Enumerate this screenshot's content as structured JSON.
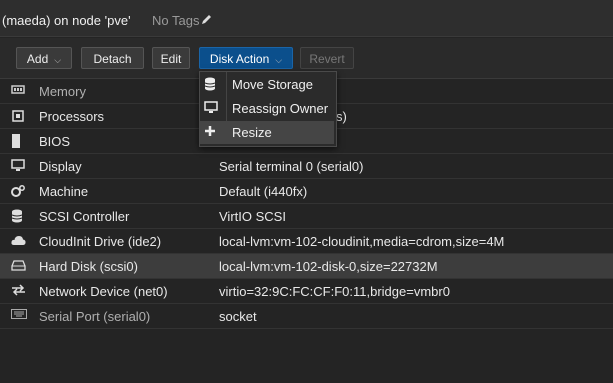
{
  "header": {
    "title": "(maeda) on node 'pve'",
    "tags": "No Tags",
    "tags_icon": "pencil-icon"
  },
  "toolbar": {
    "add_label": "Add",
    "detach_label": "Detach",
    "edit_label": "Edit",
    "disk_action_label": "Disk Action",
    "revert_label": "Revert"
  },
  "disk_menu": {
    "items": [
      {
        "label": "Move Storage",
        "icon": "database-icon"
      },
      {
        "label": "Reassign Owner",
        "icon": "monitor-icon"
      },
      {
        "label": "Resize",
        "icon": "plus-icon"
      }
    ]
  },
  "hardware": {
    "rows": [
      {
        "label": "Memory",
        "value": "",
        "icon": "memory-icon"
      },
      {
        "label": "Processors",
        "value": "s)",
        "icon": "cpu-icon"
      },
      {
        "label": "BIOS",
        "value": "",
        "icon": "chip-icon"
      },
      {
        "label": "Display",
        "value": "Serial terminal 0 (serial0)",
        "icon": "monitor-icon"
      },
      {
        "label": "Machine",
        "value": "Default (i440fx)",
        "icon": "cogs-icon"
      },
      {
        "label": "SCSI Controller",
        "value": "VirtIO SCSI",
        "icon": "database-icon"
      },
      {
        "label": "CloudInit Drive (ide2)",
        "value": "local-lvm:vm-102-cloudinit,media=cdrom,size=4M",
        "icon": "cloud-icon"
      },
      {
        "label": "Hard Disk (scsi0)",
        "value": "local-lvm:vm-102-disk-0,size=22732M",
        "icon": "hdd-icon"
      },
      {
        "label": "Network Device (net0)",
        "value": "virtio=32:9C:FC:CF:F0:11,bridge=vmbr0",
        "icon": "exchange-icon"
      },
      {
        "label": "Serial Port (serial0)",
        "value": "socket",
        "icon": "keyboard-icon"
      }
    ]
  }
}
